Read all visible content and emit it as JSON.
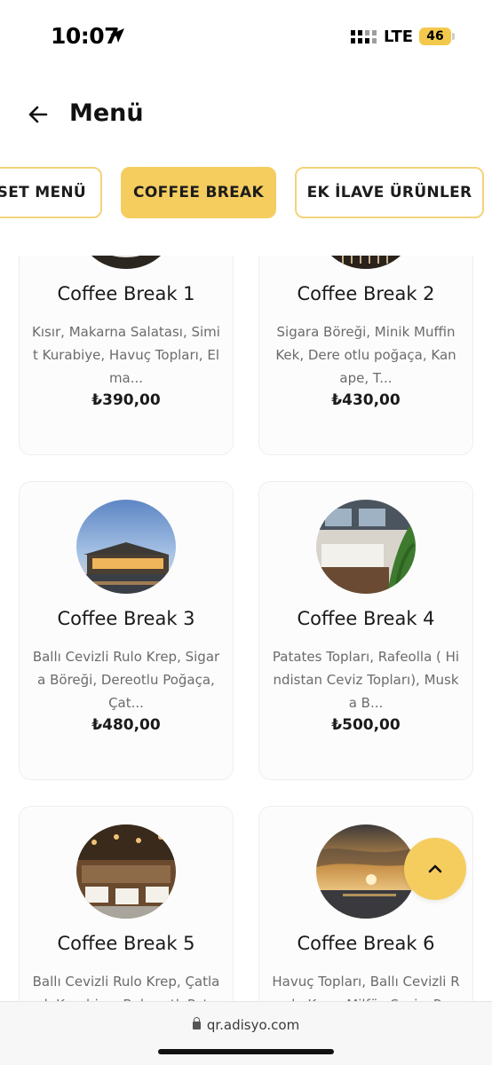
{
  "status_bar": {
    "time": "10:07",
    "network": "LTE",
    "battery": "46"
  },
  "header": {
    "title": "Menü"
  },
  "tabs": [
    {
      "label": "SET MENÜ",
      "active": false
    },
    {
      "label": "COFFEE BREAK",
      "active": true
    },
    {
      "label": "EK İLAVE ÜRÜNLER",
      "active": false
    }
  ],
  "items": [
    {
      "title": "Coffee Break 1",
      "description": "Kısır, Makarna Salatası, Simit Kurabiye, Havuç Topları, Elma...",
      "price": "₺390,00"
    },
    {
      "title": "Coffee Break 2",
      "description": "Sigara Böreği, Minik Muffin Kek, Dere otlu poğaça, Kanape, T...",
      "price": "₺430,00"
    },
    {
      "title": "Coffee Break 3",
      "description": "Ballı Cevizli Rulo Krep, Sigara Böreği, Dereotlu Poğaça, Çat...",
      "price": "₺480,00"
    },
    {
      "title": "Coffee Break 4",
      "description": "Patates Topları, Rafeolla ( Hindistan Ceviz Topları), Muska B...",
      "price": "₺500,00"
    },
    {
      "title": "Coffee Break 5",
      "description": "Ballı Cevizli Rulo Krep, Çatlak Kurabiye, Baharatlı Pat",
      "price": ""
    },
    {
      "title": "Coffee Break 6",
      "description": "Havuç Topları, Ballı Cevizli Rulo Krep, Milföy Sosis, Pa",
      "price": ""
    }
  ],
  "browser": {
    "url": "qr.adisyo.com"
  },
  "colors": {
    "accent": "#f5cd5f",
    "tab_border": "#f3d37a"
  }
}
